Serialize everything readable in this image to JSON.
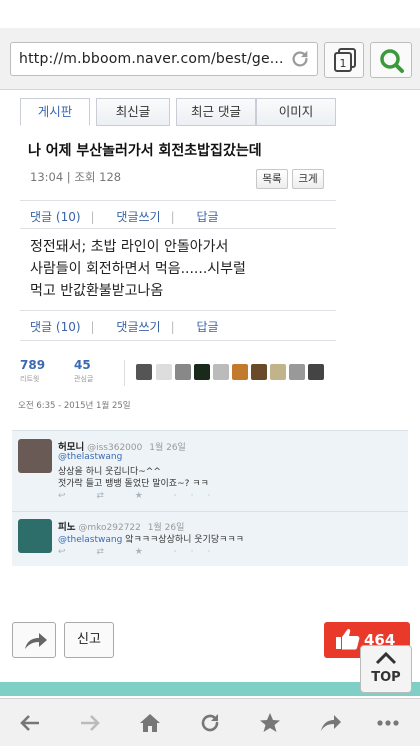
{
  "browser": {
    "url": "http://m.bboom.naver.com/best/ge...",
    "tab_count": "1",
    "colors": {
      "search_green": "#3a9a3a",
      "accent_blue": "#3b6ab3",
      "like_red": "#e8392b"
    }
  },
  "post": {
    "tabs": [
      "게시판",
      "최신글",
      "최근 댓글",
      "이미지"
    ],
    "title": "나 어제 부산놀러가서 회전초밥집갔는데",
    "meta": "13:04 | 조회 128",
    "list_button": "목록",
    "size_button": "크게",
    "comment_bar": {
      "comments": "댓글 (10)",
      "write": "댓글쓰기",
      "reply": "답글"
    },
    "body_lines": [
      "정전돼서; 초밥 라인이 안돌아가서",
      "사람들이 회전하면서 먹음......시부럴",
      "먹고 반값환불받고나옴"
    ]
  },
  "stats": {
    "retweets": "789",
    "retweets_label": "리트윗",
    "favorites": "45",
    "favorites_label": "관심글"
  },
  "timestamp": "오전 6:35 - 2015년 1월 25일",
  "replies": [
    {
      "name": "허모니",
      "handle": "@iss362000",
      "date": "1월 26일",
      "mention": "@thelastwang",
      "lines": [
        "상상을 하니 웃깁니다~^^",
        "젓가락 들고 뱅뱅 돌었단 말이죠~? ㅋㅋ"
      ]
    },
    {
      "name": "피노",
      "handle": "@mko292722",
      "date": "1월 26일",
      "mention": "@thelastwang",
      "lines": [
        "앜ㅋㅋㅋ상상하니 웃기당ㅋㅋㅋ"
      ]
    }
  ],
  "reply_actions": "↩ ⇄ ★ ···",
  "bottom": {
    "report_label": "신고",
    "like_count": "464",
    "top_label": "TOP"
  }
}
